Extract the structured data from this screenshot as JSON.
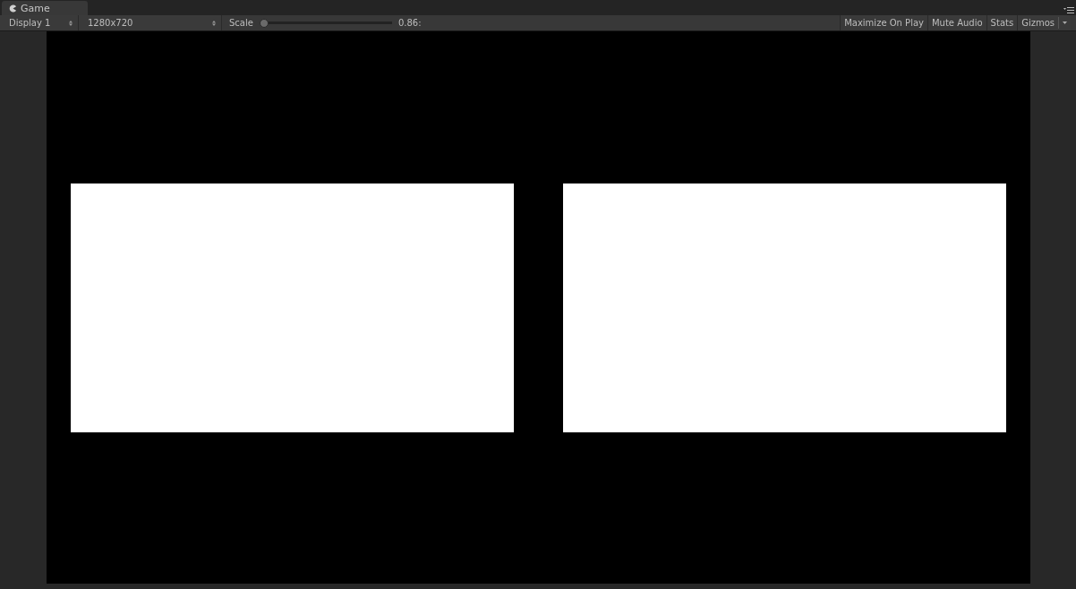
{
  "tab": {
    "title": "Game",
    "selected": true
  },
  "toolbar": {
    "display": "Display 1",
    "resolution": "1280x720",
    "scale": {
      "label": "Scale",
      "level": 0,
      "reading": "0.86:"
    },
    "toggles": [
      {
        "label": "Maximize On Play",
        "on": false
      },
      {
        "label": "Mute Audio",
        "on": false
      },
      {
        "label": "Stats",
        "on": false
      },
      {
        "label": "Gizmos",
        "on": false,
        "kind": "dropdown"
      }
    ]
  }
}
